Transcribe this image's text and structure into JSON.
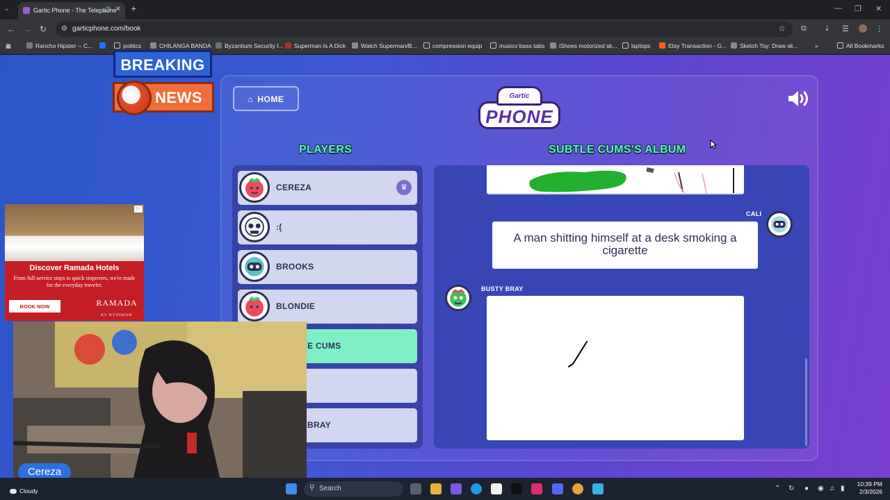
{
  "browser": {
    "tab_title": "Gartic Phone - The Telephone",
    "url": "garticphone.com/book",
    "bookmarks": [
      "Rancho Hipster -- C...",
      "politics",
      "CHILANGA BANDA",
      "Byzantium Security I...",
      "Superman Is A Dick",
      "Watch Superman/B...",
      "compression equip",
      "musicv bass tabs",
      "iShoes motorized sk...",
      "laptops",
      "Etsy Transaction - G...",
      "Sketch Toy: Draw sk..."
    ],
    "all_bookmarks": "All Bookmarks"
  },
  "page": {
    "home_label": "HOME",
    "logo_top": "Gartic",
    "logo_bottom": "PHONE",
    "players_title": "PLAYERS",
    "album_title": "SUBTLE CUMS'S ALBUM",
    "players": [
      {
        "name": "CEREZA",
        "owner": true
      },
      {
        "name": ":("
      },
      {
        "name": "BROOKS"
      },
      {
        "name": "BLONDIE"
      },
      {
        "name": "E CUMS",
        "active": true
      },
      {
        "name": ""
      },
      {
        "name": "BRAY"
      }
    ],
    "album": {
      "entry1_user": "CALI",
      "entry1_text": "A man shitting himself at a desk smoking a cigarette",
      "entry2_user": "BUSTY BRAY"
    }
  },
  "overlay": {
    "breaking": "BREAKING",
    "news": "NEWS",
    "ad_headline": "Discover Ramada Hotels",
    "ad_text": "From full-service stays to quick stopovers, we're made for the everyday traveler.",
    "ad_button": "BOOK NOW",
    "ad_brand": "RAMADA",
    "ad_sub": "BY WYNDHAM",
    "webcam_name": "Cereza"
  },
  "taskbar": {
    "weather": "Cloudy",
    "search_placeholder": "Search",
    "time": "10:39 PM",
    "date": "2/3/2026"
  }
}
